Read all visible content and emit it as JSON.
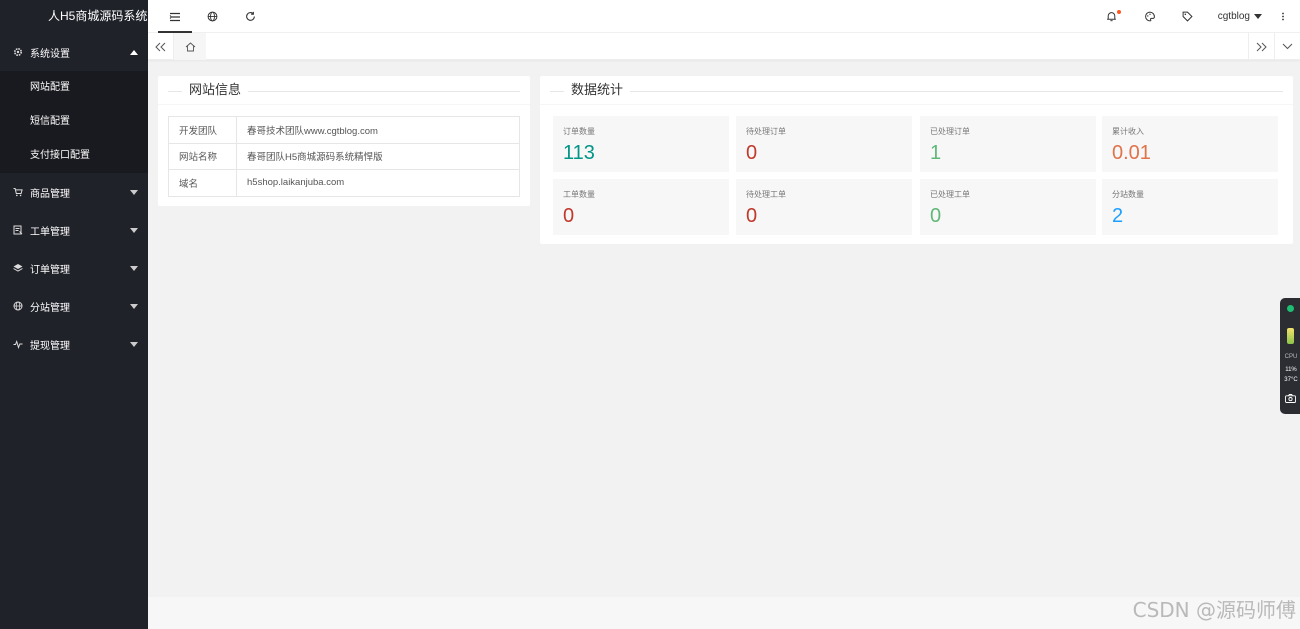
{
  "sidebar": {
    "logo": "人H5商城源码系统",
    "menu": [
      {
        "label": "系统设置",
        "icon": "gear-icon",
        "expanded": true,
        "children": [
          "网站配置",
          "短信配置",
          "支付接口配置"
        ]
      },
      {
        "label": "商品管理",
        "icon": "cart-icon"
      },
      {
        "label": "工单管理",
        "icon": "ticket-icon"
      },
      {
        "label": "订单管理",
        "icon": "layers-icon"
      },
      {
        "label": "分站管理",
        "icon": "globe-icon"
      },
      {
        "label": "提现管理",
        "icon": "pulse-icon"
      }
    ]
  },
  "header": {
    "user": "cgtblog"
  },
  "info_card": {
    "title": "网站信息",
    "rows": [
      {
        "key": "开发团队",
        "value": "春哥技术团队www.cgtblog.com"
      },
      {
        "key": "网站名称",
        "value": "春哥团队H5商城源码系统精悍版"
      },
      {
        "key": "域名",
        "value": "h5shop.laikanjuba.com"
      }
    ]
  },
  "stats_card": {
    "title": "数据统计",
    "items": [
      {
        "label": "订单数量",
        "value": "113",
        "color": "#009688"
      },
      {
        "label": "待处理订单",
        "value": "0",
        "color": "#c0392b"
      },
      {
        "label": "已处理订单",
        "value": "1",
        "color": "#5fb878"
      },
      {
        "label": "累计收入",
        "value": "0.01",
        "color": "#e0734a"
      },
      {
        "label": "工单数量",
        "value": "0",
        "color": "#c0392b"
      },
      {
        "label": "待处理工单",
        "value": "0",
        "color": "#c0392b"
      },
      {
        "label": "已处理工单",
        "value": "0",
        "color": "#5fb878"
      },
      {
        "label": "分站数量",
        "value": "2",
        "color": "#1e9fff"
      }
    ]
  },
  "widget": {
    "label": "CPU",
    "usage": "11%",
    "temp": "37°C"
  },
  "watermark": "CSDN @源码师傅"
}
